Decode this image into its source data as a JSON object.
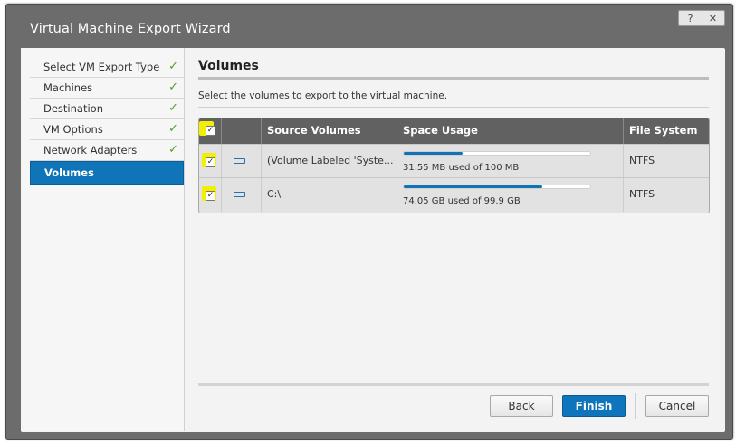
{
  "window": {
    "title": "Virtual Machine Export Wizard",
    "help_label": "?",
    "close_label": "✕"
  },
  "sidebar": {
    "items": [
      {
        "label": "Select VM Export Type",
        "completed": true
      },
      {
        "label": "Machines",
        "completed": true
      },
      {
        "label": "Destination",
        "completed": true
      },
      {
        "label": "VM Options",
        "completed": true
      },
      {
        "label": "Network Adapters",
        "completed": true
      },
      {
        "label": "Volumes",
        "active": true
      }
    ],
    "check_glyph": "✓"
  },
  "main": {
    "heading": "Volumes",
    "instruction": "Select the volumes to export to the virtual machine.",
    "table": {
      "columns": [
        "",
        "",
        "Source Volumes",
        "Space Usage",
        "File System"
      ],
      "select_all_checked": true,
      "rows": [
        {
          "checked": true,
          "icon": "volume-icon",
          "source": "(Volume Labeled 'Syste...",
          "usage_fraction": 0.3155,
          "usage_text": "31.55 MB used of 100 MB",
          "file_system": "NTFS"
        },
        {
          "checked": true,
          "icon": "volume-icon",
          "source": "C:\\",
          "usage_fraction": 0.7412,
          "usage_text": "74.05 GB used of 99.9 GB",
          "file_system": "NTFS"
        }
      ]
    }
  },
  "footer": {
    "back_label": "Back",
    "finish_label": "Finish",
    "cancel_label": "Cancel"
  },
  "colors": {
    "accent": "#0f74b8",
    "highlight": "#f0f000",
    "success": "#4a9f2a",
    "header_bg": "#616161"
  }
}
